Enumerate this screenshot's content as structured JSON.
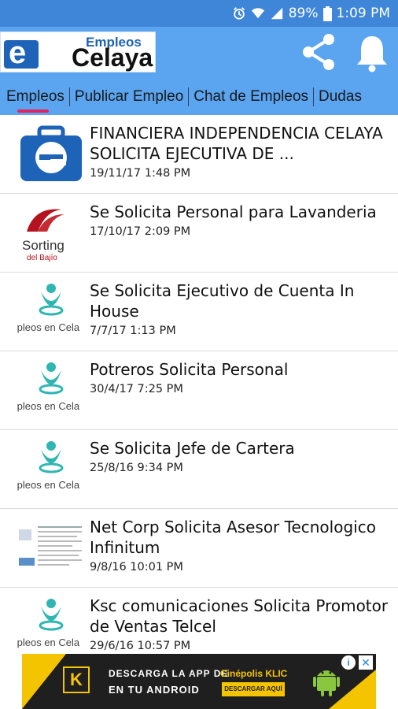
{
  "status_bar": {
    "battery": "89%",
    "time": "1:09 PM",
    "icons": [
      "alarm-icon",
      "wifi-icon",
      "signal-icon",
      "battery-icon"
    ]
  },
  "app_bar": {
    "logo_top": "Empleos",
    "logo_bottom": "Celaya",
    "share_icon": "share-icon",
    "bell_icon": "bell-icon",
    "color": "#5aa4f0"
  },
  "tabs": [
    {
      "label": "Empleos",
      "active": true
    },
    {
      "label": "Publicar Empleo",
      "active": false
    },
    {
      "label": "Chat de Empleos",
      "active": false
    },
    {
      "label": "Dudas",
      "active": false
    }
  ],
  "jobs": [
    {
      "title": "FINANCIERA INDEPENDENCIA CELAYA SOLICITA EJECUTIVA DE ...",
      "date": "19/11/17 1:48 PM",
      "thumb": "empleos-celaya-logo"
    },
    {
      "title": "Se Solicita Personal para Lavanderia",
      "date": "17/10/17 2:09 PM",
      "thumb": "sorting-logo",
      "thumb_text": "Sorting",
      "thumb_subtext": "del Bajío"
    },
    {
      "title": "Se Solicita Ejecutivo de Cuenta In House",
      "date": "7/7/17 1:13 PM",
      "thumb": "empleos-en-celaya-logo",
      "thumb_text": "ıpleos en Cela"
    },
    {
      "title": "Potreros Solicita Personal",
      "date": "30/4/17 7:25 PM",
      "thumb": "empleos-en-celaya-logo",
      "thumb_text": "ıpleos en Cela"
    },
    {
      "title": "Se Solicita Jefe de Cartera",
      "date": "25/8/16 9:34 PM",
      "thumb": "empleos-en-celaya-logo",
      "thumb_text": "ıpleos en Cela"
    },
    {
      "title": "Net Corp Solicita Asesor Tecnologico Infinitum",
      "date": "9/8/16 10:01 PM",
      "thumb": "document-thumbnail"
    },
    {
      "title": "Ksc comunicaciones Solicita Promotor de Ventas Telcel",
      "date": "29/6/16 10:57 PM",
      "thumb": "empleos-en-celaya-logo",
      "thumb_text": "ıpleos en Cela"
    }
  ],
  "ad": {
    "line1": "DESCARGA LA APP DE",
    "brand": "Cinépolis KLIC",
    "line2": "EN TU ANDROID",
    "cta": "DESCARGAR AQUÍ",
    "badge": "K",
    "accent": "#f5c400"
  }
}
